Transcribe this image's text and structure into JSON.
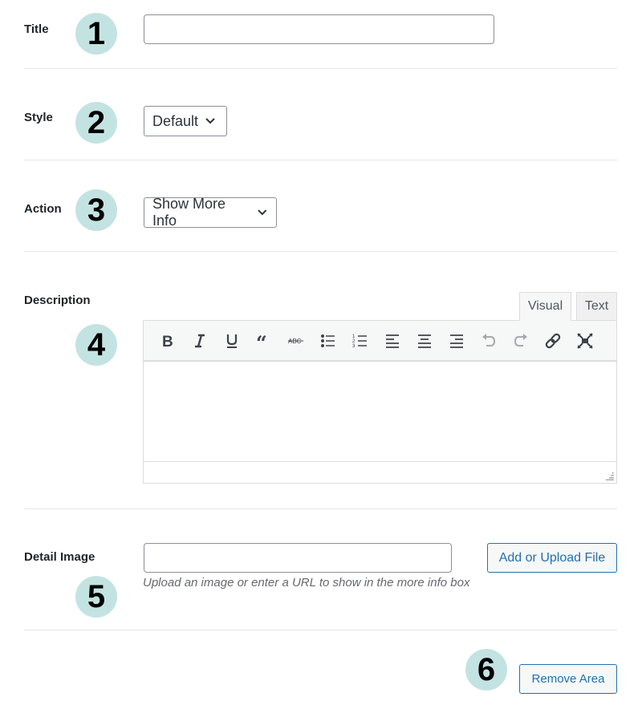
{
  "fields": {
    "title": {
      "label": "Title",
      "badge": "1",
      "value": "",
      "placeholder": ""
    },
    "style": {
      "label": "Style",
      "badge": "2",
      "selected": "Default"
    },
    "action": {
      "label": "Action",
      "badge": "3",
      "selected": "Show More Info"
    },
    "description": {
      "label": "Description",
      "badge": "4",
      "tabs": [
        {
          "label": "Visual",
          "active": true
        },
        {
          "label": "Text",
          "active": false
        }
      ],
      "toolbar": [
        {
          "icon": "bold-icon",
          "title": "Bold"
        },
        {
          "icon": "italic-icon",
          "title": "Italic"
        },
        {
          "icon": "underline-icon",
          "title": "Underline"
        },
        {
          "icon": "blockquote-icon",
          "title": "Blockquote"
        },
        {
          "icon": "strikethrough-icon",
          "title": "Strikethrough"
        },
        {
          "icon": "bullet-list-icon",
          "title": "Bulleted list"
        },
        {
          "icon": "numbered-list-icon",
          "title": "Numbered list"
        },
        {
          "icon": "align-left-icon",
          "title": "Align left"
        },
        {
          "icon": "align-center-icon",
          "title": "Align center"
        },
        {
          "icon": "align-right-icon",
          "title": "Align right"
        },
        {
          "icon": "undo-icon",
          "title": "Undo"
        },
        {
          "icon": "redo-icon",
          "title": "Redo"
        },
        {
          "icon": "link-icon",
          "title": "Insert/edit link"
        },
        {
          "icon": "fullscreen-icon",
          "title": "Fullscreen"
        }
      ],
      "content": ""
    },
    "detail_image": {
      "label": "Detail Image",
      "badge": "5",
      "value": "",
      "button_label": "Add or Upload File",
      "hint": "Upload an image or enter a URL to show in the more info box"
    }
  },
  "remove": {
    "badge": "6",
    "button_label": "Remove Area"
  },
  "colors": {
    "badge_bg": "#c3e3e2",
    "accent": "#2271b1",
    "border": "#8c8f94"
  }
}
